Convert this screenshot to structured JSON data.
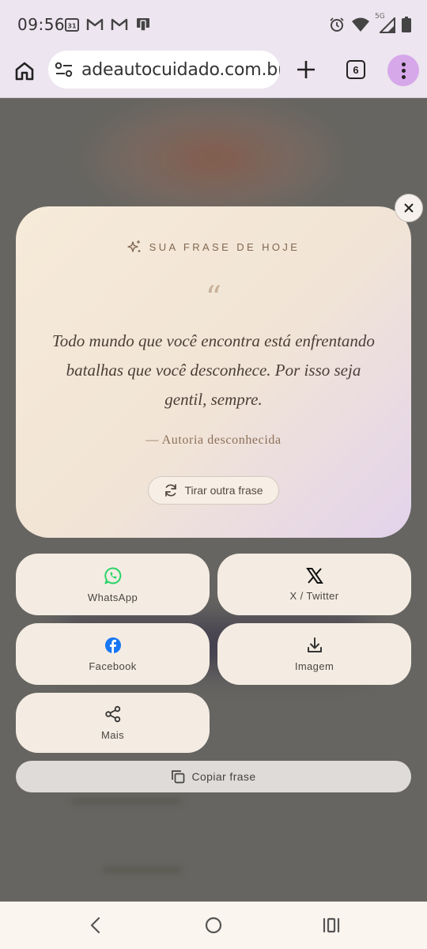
{
  "status_bar": {
    "time": "09:56",
    "notification_icons": [
      "calendar-icon",
      "gmail-icon",
      "gmail-icon",
      "device-icon"
    ],
    "calendar_day": "31",
    "network_label": "5G",
    "system_icons": [
      "alarm-icon",
      "wifi-icon",
      "cell-signal-icon",
      "battery-icon"
    ]
  },
  "browser": {
    "url": "adeautocuidado.com.br",
    "tab_count": "6"
  },
  "quote_card": {
    "header": "SUA FRASE DE HOJE",
    "quote_mark": "“",
    "quote": "Todo mundo que você encontra está enfrentando batalhas que você desconhece. Por isso seja gentil, sempre.",
    "author": "— Autoria desconhecida",
    "refresh_label": "Tirar outra frase"
  },
  "share": {
    "whatsapp": "WhatsApp",
    "twitter": "X / Twitter",
    "facebook": "Facebook",
    "image": "Imagem",
    "more": "Mais",
    "copy": "Copiar frase"
  },
  "colors": {
    "whatsapp": "#25d366",
    "facebook": "#1877f2",
    "menu_accent": "#d6a8ea",
    "card_accent": "#806851"
  }
}
